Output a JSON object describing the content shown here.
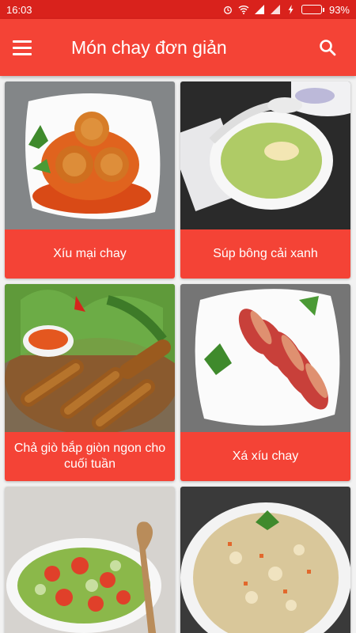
{
  "status": {
    "time": "16:03",
    "battery": "93%",
    "battery_level": 0.93
  },
  "app_bar": {
    "title": "Món chay đơn giản"
  },
  "dishes": [
    {
      "label": "Xíu mại chay"
    },
    {
      "label": "Súp bông cải xanh"
    },
    {
      "label": "Chả giò bắp giòn ngon cho cuối tuần"
    },
    {
      "label": "Xá xíu chay"
    }
  ],
  "colors": {
    "status_bar": "#d9221c",
    "app_bar": "#f44336",
    "card_label": "#f44336"
  },
  "icons": {
    "menu": "hamburger-menu-icon",
    "search": "search-icon"
  }
}
